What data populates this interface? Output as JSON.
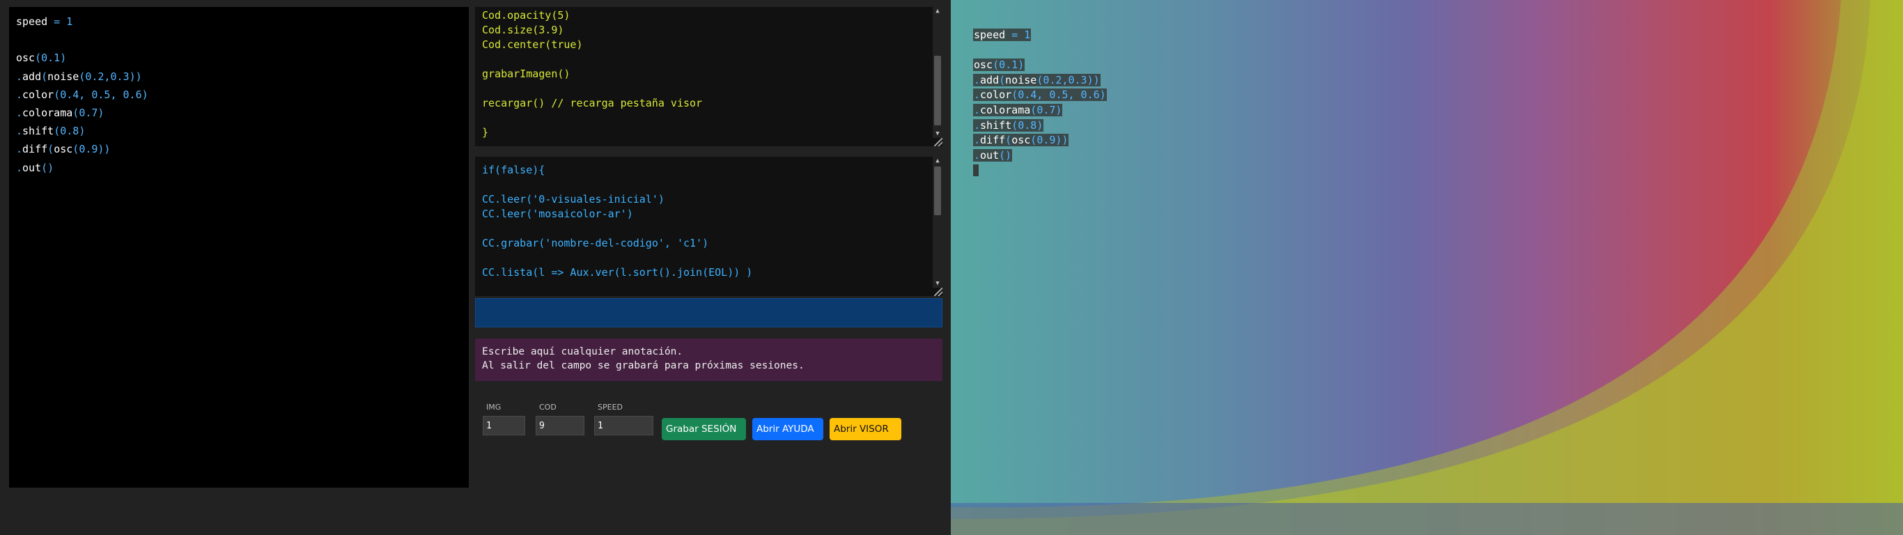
{
  "main_editor": {
    "lines": [
      [
        {
          "t": "speed",
          "c": ""
        },
        {
          "t": " = ",
          "c": "op"
        },
        {
          "t": "1",
          "c": "num"
        }
      ],
      [],
      [
        {
          "t": "osc",
          "c": ""
        },
        {
          "t": "(",
          "c": "op"
        },
        {
          "t": "0.1",
          "c": "num"
        },
        {
          "t": ")",
          "c": "op"
        }
      ],
      [
        {
          "t": ".",
          "c": "op"
        },
        {
          "t": "add",
          "c": ""
        },
        {
          "t": "(",
          "c": "op"
        },
        {
          "t": "noise",
          "c": ""
        },
        {
          "t": "(",
          "c": "op"
        },
        {
          "t": "0.2",
          "c": "num"
        },
        {
          "t": ",",
          "c": "op"
        },
        {
          "t": "0.3",
          "c": "num"
        },
        {
          "t": "))",
          "c": "op"
        }
      ],
      [
        {
          "t": ".",
          "c": "op"
        },
        {
          "t": "color",
          "c": ""
        },
        {
          "t": "(",
          "c": "op"
        },
        {
          "t": "0.4, 0.5, 0.6",
          "c": "num"
        },
        {
          "t": ")",
          "c": "op"
        }
      ],
      [
        {
          "t": ".",
          "c": "op"
        },
        {
          "t": "colorama",
          "c": ""
        },
        {
          "t": "(",
          "c": "op"
        },
        {
          "t": "0.7",
          "c": "num"
        },
        {
          "t": ")",
          "c": "op"
        }
      ],
      [
        {
          "t": ".",
          "c": "op"
        },
        {
          "t": "shift",
          "c": ""
        },
        {
          "t": "(",
          "c": "op"
        },
        {
          "t": "0.8",
          "c": "num"
        },
        {
          "t": ")",
          "c": "op"
        }
      ],
      [
        {
          "t": ".",
          "c": "op"
        },
        {
          "t": "diff",
          "c": ""
        },
        {
          "t": "(",
          "c": "op"
        },
        {
          "t": "osc",
          "c": ""
        },
        {
          "t": "(",
          "c": "op"
        },
        {
          "t": "0.9",
          "c": "num"
        },
        {
          "t": "))",
          "c": "op"
        }
      ],
      [
        {
          "t": ".",
          "c": "op"
        },
        {
          "t": "out",
          "c": ""
        },
        {
          "t": "()",
          "c": "op"
        }
      ]
    ]
  },
  "editor_top": {
    "lines": [
      "Cod.opacity(5)",
      "Cod.size(3.9)",
      "Cod.center(true)",
      "",
      "grabarImagen()",
      "",
      "recargar() // recarga pestaña visor",
      "",
      "}"
    ]
  },
  "editor_middle": {
    "lines": [
      "if(false){",
      "",
      "CC.leer('0-visuales-inicial')",
      "CC.leer('mosaicolor-ar')",
      "",
      "CC.grabar('nombre-del-codigo', 'c1')",
      "",
      "CC.lista(l => Aux.ver(l.sort().join(EOL)) )"
    ]
  },
  "notes": {
    "line1": "Escribe aquí cualquier anotación.",
    "line2": "Al salir del campo se grabará para próximas sesiones."
  },
  "fields": {
    "img_label": "IMG",
    "img_value": "1",
    "cod_label": "COD",
    "cod_value": "9",
    "speed_label": "SPEED",
    "speed_value": "1"
  },
  "buttons": {
    "grabar": "Grabar SESIÓN",
    "ayuda": "Abrir AYUDA",
    "visor": "Abrir VISOR"
  },
  "overlay": {
    "lines": [
      [
        {
          "t": "speed",
          "c": ""
        },
        {
          "t": " = ",
          "c": "op"
        },
        {
          "t": "1",
          "c": "num"
        }
      ],
      [],
      [
        {
          "t": "osc",
          "c": ""
        },
        {
          "t": "(",
          "c": "op"
        },
        {
          "t": "0.1",
          "c": "num"
        },
        {
          "t": ")",
          "c": "op"
        }
      ],
      [
        {
          "t": ".",
          "c": "op"
        },
        {
          "t": "add",
          "c": ""
        },
        {
          "t": "(",
          "c": "op"
        },
        {
          "t": "noise",
          "c": ""
        },
        {
          "t": "(",
          "c": "op"
        },
        {
          "t": "0.2",
          "c": "num"
        },
        {
          "t": ",",
          "c": "op"
        },
        {
          "t": "0.3",
          "c": "num"
        },
        {
          "t": "))",
          "c": "op"
        }
      ],
      [
        {
          "t": ".",
          "c": "op"
        },
        {
          "t": "color",
          "c": ""
        },
        {
          "t": "(",
          "c": "op"
        },
        {
          "t": "0.4, 0.5, 0.6",
          "c": "num"
        },
        {
          "t": ")",
          "c": "op"
        }
      ],
      [
        {
          "t": ".",
          "c": "op"
        },
        {
          "t": "colorama",
          "c": ""
        },
        {
          "t": "(",
          "c": "op"
        },
        {
          "t": "0.7",
          "c": "num"
        },
        {
          "t": ")",
          "c": "op"
        }
      ],
      [
        {
          "t": ".",
          "c": "op"
        },
        {
          "t": "shift",
          "c": ""
        },
        {
          "t": "(",
          "c": "op"
        },
        {
          "t": "0.8",
          "c": "num"
        },
        {
          "t": ")",
          "c": "op"
        }
      ],
      [
        {
          "t": ".",
          "c": "op"
        },
        {
          "t": "diff",
          "c": ""
        },
        {
          "t": "(",
          "c": "op"
        },
        {
          "t": "osc",
          "c": ""
        },
        {
          "t": "(",
          "c": "op"
        },
        {
          "t": "0.9",
          "c": "num"
        },
        {
          "t": "))",
          "c": "op"
        }
      ],
      [
        {
          "t": ".",
          "c": "op"
        },
        {
          "t": "out",
          "c": ""
        },
        {
          "t": "()",
          "c": "op"
        }
      ]
    ]
  },
  "colors": {
    "number": "#54b6ff",
    "yellow_code": "#d8e836",
    "blue_code": "#3db2ff",
    "notes_bg": "#441f40",
    "blue_bar": "#0b3b6e"
  }
}
